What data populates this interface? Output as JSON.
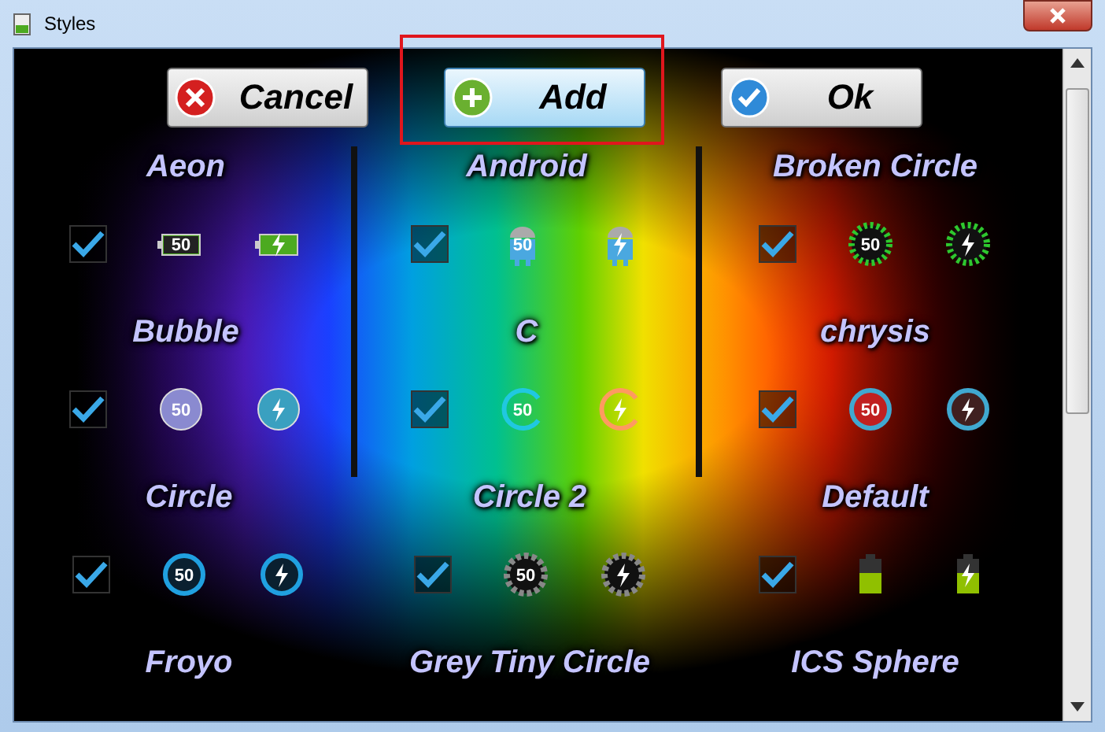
{
  "window": {
    "title": "Styles"
  },
  "buttons": [
    {
      "label": "Cancel",
      "kind": "cancel",
      "highlighted": false
    },
    {
      "label": "Add",
      "kind": "add",
      "highlighted": true
    },
    {
      "label": "Ok",
      "kind": "ok",
      "highlighted": false
    }
  ],
  "styles": [
    {
      "name": "Aeon",
      "checked": true,
      "kind": "battery",
      "charge": "50"
    },
    {
      "name": "Android",
      "checked": true,
      "kind": "robot",
      "charge": "50"
    },
    {
      "name": "Broken Circle",
      "checked": true,
      "kind": "dashed",
      "charge": "50"
    },
    {
      "name": "Bubble",
      "checked": true,
      "kind": "bubble",
      "charge": "50"
    },
    {
      "name": "C",
      "checked": true,
      "kind": "arc",
      "charge": "50"
    },
    {
      "name": "chrysis",
      "checked": true,
      "kind": "redring",
      "charge": "50"
    },
    {
      "name": "Circle",
      "checked": true,
      "kind": "ring",
      "charge": "50"
    },
    {
      "name": "Circle 2",
      "checked": true,
      "kind": "gear",
      "charge": "50"
    },
    {
      "name": "Default",
      "checked": true,
      "kind": "block"
    },
    {
      "name": "Froyo"
    },
    {
      "name": "Grey Tiny Circle"
    },
    {
      "name": "ICS Sphere"
    }
  ]
}
